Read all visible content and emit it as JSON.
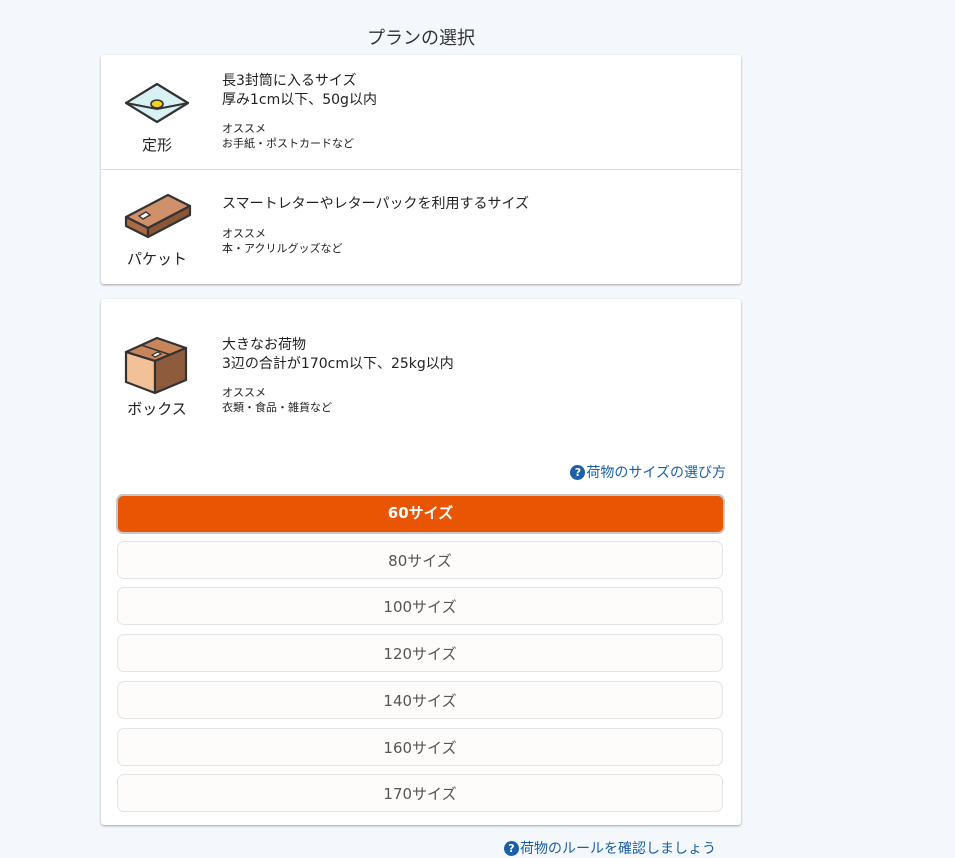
{
  "page_title": "プランの選択",
  "plans": [
    {
      "name": "定形",
      "icon": "envelope-icon",
      "desc_line1": "長3封筒に入るサイズ",
      "desc_line2": "厚み1cm以下、50g以内",
      "rec_label": "オススメ",
      "rec_items": "お手紙・ポストカードなど"
    },
    {
      "name": "パケット",
      "icon": "packet-icon",
      "desc_line1": "スマートレターやレターパックを利用するサイズ",
      "rec_label": "オススメ",
      "rec_items": "本・アクリルグッズなど"
    },
    {
      "name": "ボックス",
      "icon": "box-icon",
      "desc_line1": "大きなお荷物",
      "desc_line2": "3辺の合計が170cm以下、25kg以内",
      "rec_label": "オススメ",
      "rec_items": "衣類・食品・雑貨など"
    }
  ],
  "size_help": {
    "icon": "?",
    "label": "荷物のサイズの選び方"
  },
  "sizes": [
    {
      "label": "60サイズ",
      "selected": true
    },
    {
      "label": "80サイズ",
      "selected": false
    },
    {
      "label": "100サイズ",
      "selected": false
    },
    {
      "label": "120サイズ",
      "selected": false
    },
    {
      "label": "140サイズ",
      "selected": false
    },
    {
      "label": "160サイズ",
      "selected": false
    },
    {
      "label": "170サイズ",
      "selected": false
    }
  ],
  "rules_help": {
    "icon": "?",
    "label": "荷物のルールを確認しましょう"
  },
  "colors": {
    "accent": "#ea5504",
    "link": "#1a5fa8",
    "background": "#f4f8fc"
  }
}
